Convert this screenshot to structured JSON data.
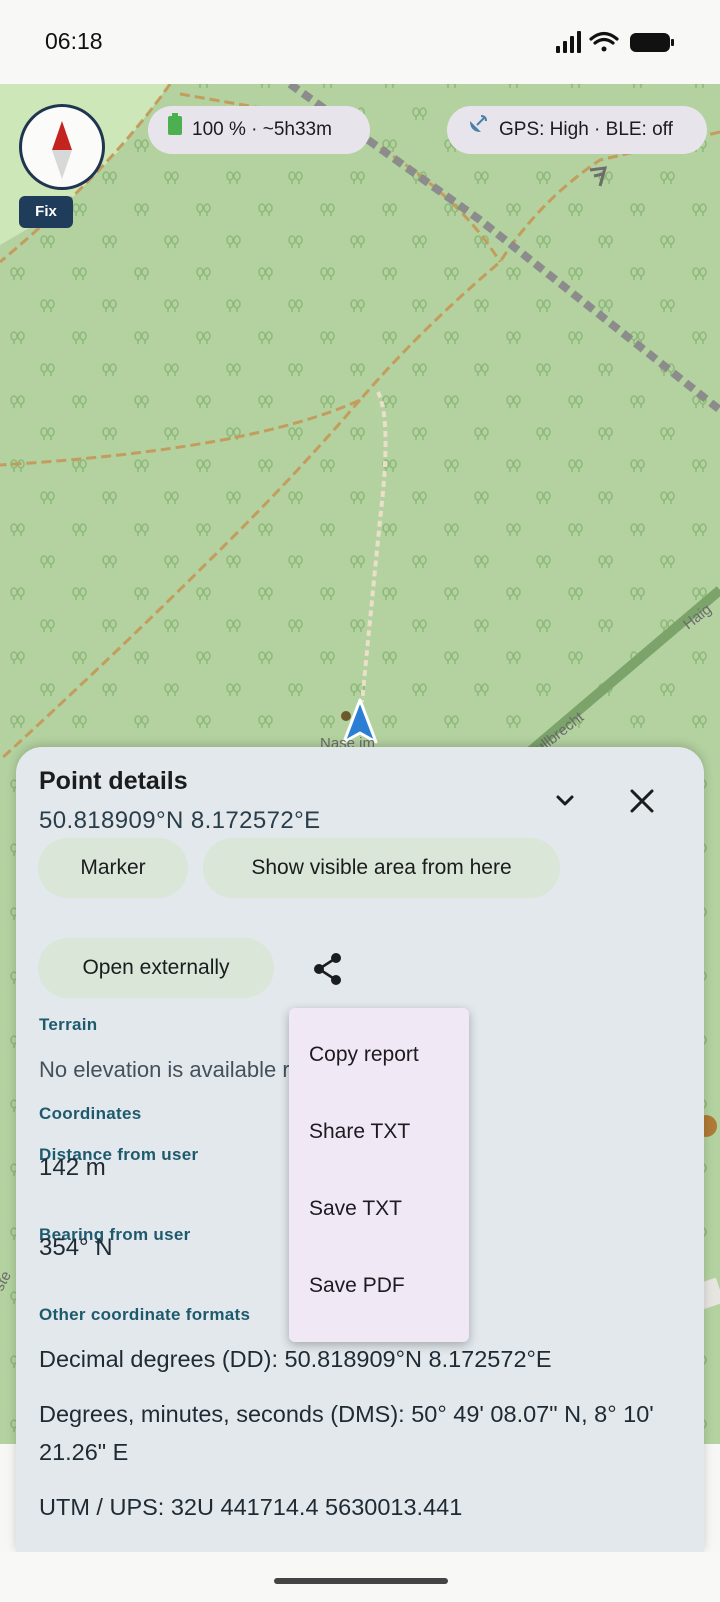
{
  "status_bar": {
    "time": "06:18",
    "icons": [
      "signal-icon",
      "wifi-icon",
      "battery-icon"
    ]
  },
  "map": {
    "compass_button": {
      "icon": "compass-icon"
    },
    "fix_badge": "Fix",
    "battery_chip": {
      "icon": "battery-icon",
      "label": "100 % · ~5h33m"
    },
    "gps_chip": {
      "icon": "satellite-icon",
      "label": "GPS: High · BLE: off"
    },
    "labels": [
      "Nase im",
      "ullbrecht",
      "Haig",
      "ste"
    ],
    "colors": {
      "forest": "#b3d2a0",
      "track": "#c8a062",
      "railway": "#8c8c8c",
      "position_arrow": "#2a7fd4"
    }
  },
  "point_details": {
    "title": "Point details",
    "coords": "50.818909°N 8.172572°E",
    "buttons": {
      "marker": "Marker",
      "visible_area": "Show visible area from here",
      "open_externally": "Open externally"
    },
    "terrain": {
      "label": "Terrain",
      "text": "No elevation is available right now."
    },
    "coordinates": {
      "label": "Coordinates",
      "distance_label": "Distance from user",
      "distance_value": "142 m",
      "bearing_label": "Bearing from user",
      "bearing_value": "354° N"
    },
    "other_formats": {
      "label": "Other coordinate formats",
      "dd": "Decimal degrees (DD): 50.818909°N 8.172572°E",
      "dms": "Degrees, minutes, seconds (DMS): 50° 49' 08.07\" N, 8° 10' 21.26\" E",
      "utm": "UTM / UPS: 32U 441714.4 5630013.441"
    }
  },
  "share_menu": {
    "items": [
      "Copy report",
      "Share TXT",
      "Save TXT",
      "Save PDF"
    ]
  }
}
